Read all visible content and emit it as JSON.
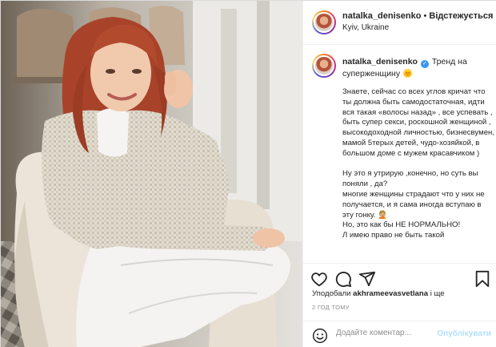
{
  "header": {
    "username": "natalka_denisenko",
    "separator": " • ",
    "follow_label": "Відстежується",
    "location": "Kyiv, Ukraine",
    "more_icon": "more-horizontal-icon"
  },
  "caption": {
    "username": "natalka_denisenko",
    "title": "Тренд на суперженщину",
    "sun_emoji": "🌞",
    "paragraphs": [
      "Знаете, сейчас со всех углов кричат что ты должна быть самодостаточная, идти вся такая «волосы назад» , все успевать , быть супер секси, роскошной женщиной , высокодоходной личностью, бизнесвумен, мамой 5терых детей, чудо-хозяйкой, в большом доме с мужем красавчиком )",
      "Ну это я утрирую ,конечно, но суть вы поняли , да?\nмногие женщины страдают что у них не получается, и я сама иногда вступаю в эту гонку. 🤦🏼\nНо, это как бы НЕ НОРМАЛЬНО!\nЛ имею право не быть такой"
    ]
  },
  "actions": {
    "like_icon": "heart-icon",
    "comment_icon": "comment-icon",
    "share_icon": "paper-plane-icon",
    "save_icon": "bookmark-icon"
  },
  "likes": {
    "prefix": "Уподобали ",
    "user": "akhrameevasvetlana",
    "suffix": " і ще"
  },
  "timestamp": "2 ГОД ТОМУ",
  "add_comment": {
    "emoji_icon": "smiley-icon",
    "placeholder": "Додайте коментар...",
    "publish_label": "Опублікувати"
  },
  "colors": {
    "link_blue": "#b2dffc",
    "verified": "#3897f0",
    "border": "#dbdbdb"
  }
}
